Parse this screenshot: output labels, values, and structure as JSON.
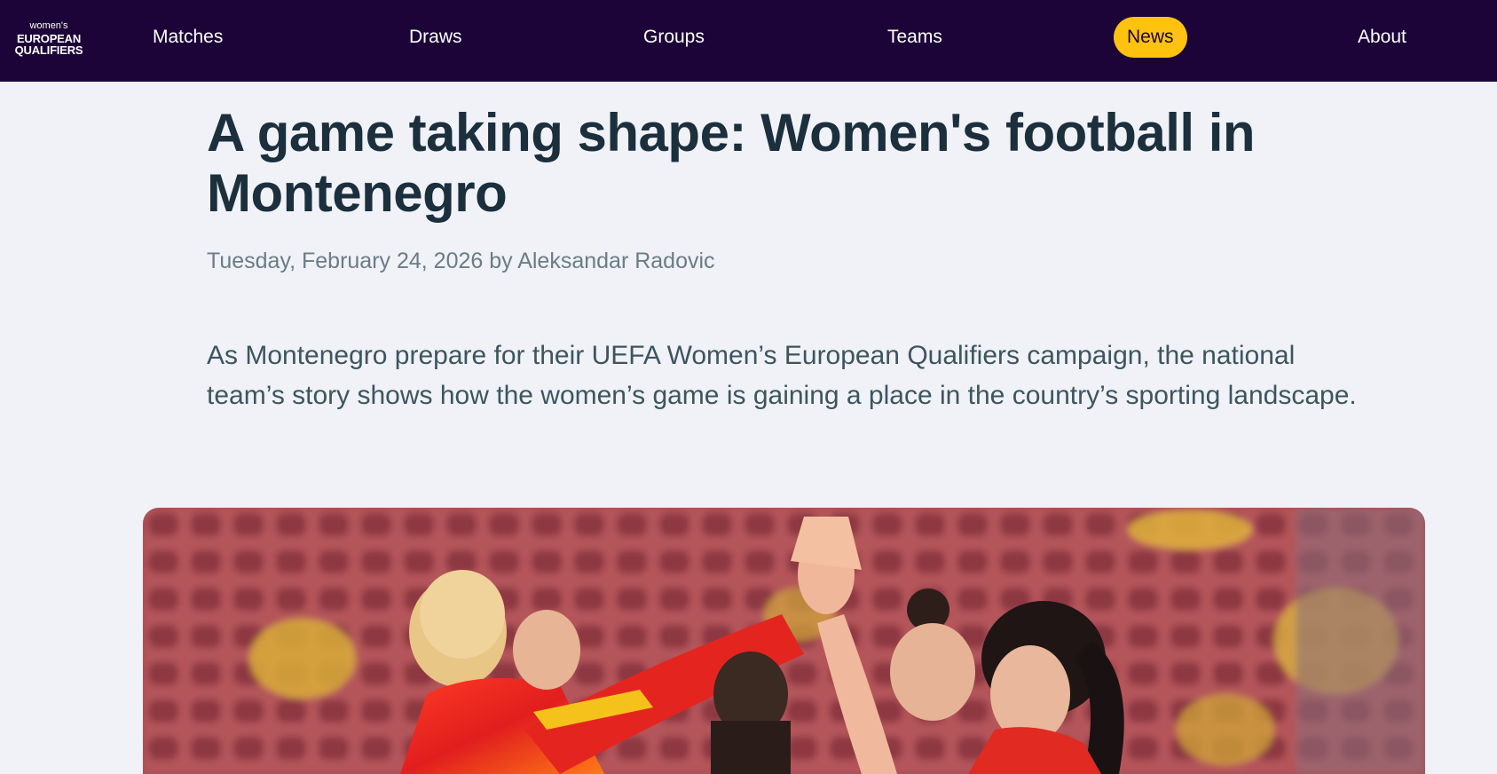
{
  "header": {
    "logo": {
      "line1": "women's",
      "line2": "EUROPEAN",
      "line3": "QUALIFIERS"
    },
    "nav": [
      {
        "label": "Matches"
      },
      {
        "label": "Draws"
      },
      {
        "label": "Groups"
      },
      {
        "label": "Teams"
      },
      {
        "label": "News",
        "active": true
      },
      {
        "label": "About"
      }
    ]
  },
  "article": {
    "title": "A game taking shape: Women's football in Montenegro",
    "byline": "Tuesday, February 24, 2026 by Aleksandar Radovic",
    "lead": "As Montenegro prepare for their UEFA Women’s European Qualifiers campaign, the national team’s story shows how the women’s game is gaining a place in the country’s sporting landscape.",
    "image": {
      "subject": "team-huddle-photo"
    }
  },
  "colors": {
    "nav_bg": "#1c0438",
    "active_pill": "#ffc20e",
    "page_bg": "#f0f2f7",
    "title": "#1b2f3d",
    "byline": "#6b7c86",
    "lead": "#3d5560"
  }
}
